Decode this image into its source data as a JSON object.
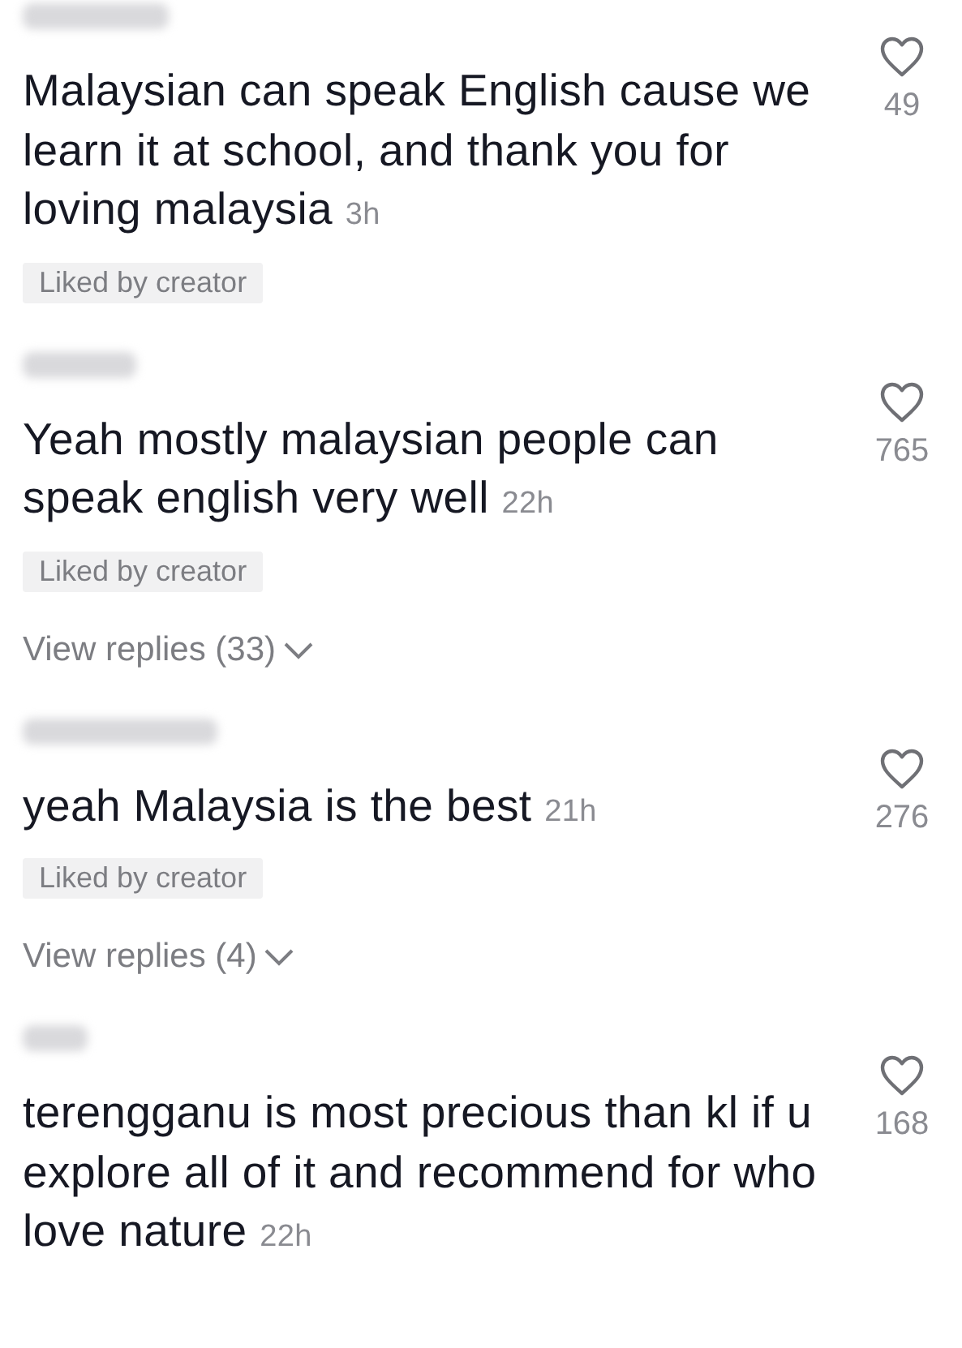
{
  "comments": [
    {
      "text": "Malaysian can speak English cause we learn it at school, and thank you for loving malaysia",
      "time": "3h",
      "likes": "49",
      "badge": "Liked by creator"
    },
    {
      "text": "Yeah mostly malaysian people can speak english very well",
      "time": "22h",
      "likes": "765",
      "badge": "Liked by creator",
      "replies": "View replies (33)"
    },
    {
      "text": "yeah Malaysia is the best",
      "time": "21h",
      "likes": "276",
      "badge": "Liked by creator",
      "replies": "View replies (4)"
    },
    {
      "text": "terengganu is most precious than kl if u explore all of it and recommend for who love nature",
      "time": "22h",
      "likes": "168"
    }
  ]
}
